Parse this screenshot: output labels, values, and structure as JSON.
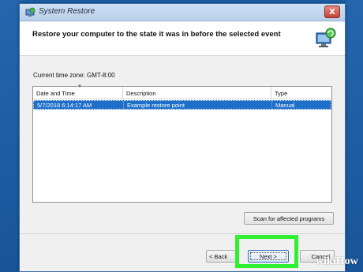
{
  "window": {
    "title": "System Restore",
    "close_label": "X"
  },
  "header": {
    "heading": "Restore your computer to the state it was in before the selected event"
  },
  "timezone_label": "Current time zone: GMT-8:00",
  "table": {
    "columns": [
      "Date and Time",
      "Description",
      "Type"
    ],
    "rows": [
      {
        "date": "5/7/2018 6:14:17 AM",
        "description": "Example restore point",
        "type": "Manual",
        "selected": true
      }
    ]
  },
  "buttons": {
    "scan": "Scan for affected programs",
    "back": "< Back",
    "next": "Next >",
    "cancel": "Cancel"
  },
  "watermark": "wikiHow",
  "colors": {
    "desktop": "#1b5fa6",
    "selection": "#1f6fc8",
    "highlight": "#2ef02e"
  },
  "icons": {
    "app": "system-restore-icon",
    "header": "restore-computer-icon",
    "sort": "sort-arrow-icon"
  }
}
